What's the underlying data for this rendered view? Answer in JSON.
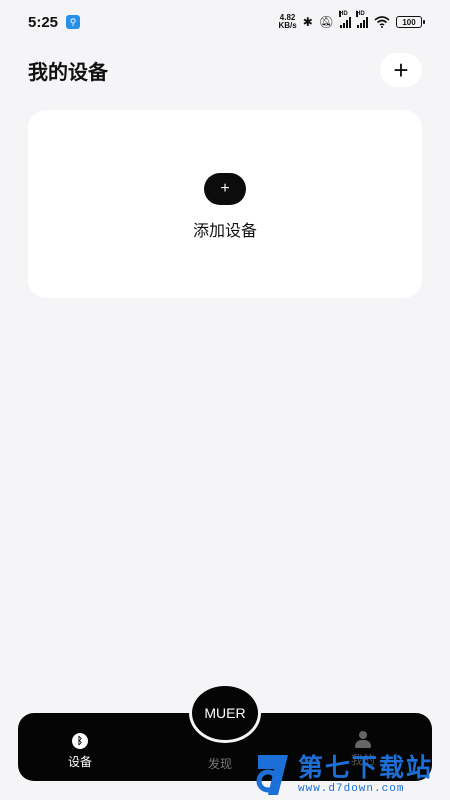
{
  "status_bar": {
    "time": "5:25",
    "net_speed_value": "4.82",
    "net_speed_unit": "KB/s",
    "signal_tag_1": "HD",
    "signal_tag_2": "HD",
    "battery": "100"
  },
  "header": {
    "title": "我的设备",
    "add_icon": "+"
  },
  "add_card": {
    "icon": "+",
    "label": "添加设备"
  },
  "bottom_nav": {
    "items": [
      {
        "label": "设备",
        "icon": "bluetooth-icon",
        "active": true
      },
      {
        "label": "发现",
        "icon": "none",
        "active": false
      },
      {
        "label": "我的",
        "icon": "person-icon",
        "active": false
      }
    ],
    "center_label": "MUER"
  },
  "watermark": {
    "title": "第七下载站",
    "url": "www.d7down.com"
  },
  "colors": {
    "background": "#f5f5f7",
    "card": "#ffffff",
    "nav": "#050505",
    "watermark": "#1b6fd6"
  }
}
